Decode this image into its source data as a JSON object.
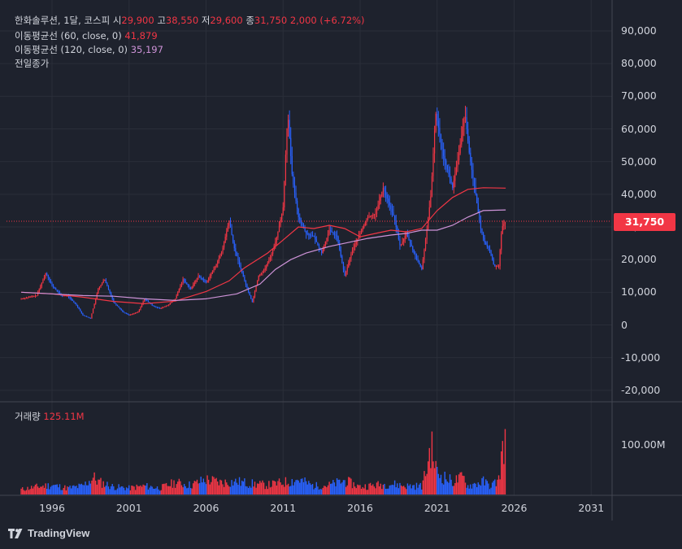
{
  "header": {
    "symbol": "한화솔루션, 1달, 코스피",
    "open_label": "시",
    "open": "29,900",
    "high_label": "고",
    "high": "38,550",
    "low_label": "저",
    "low": "29,600",
    "close_label": "종",
    "close": "31,750",
    "change": "2,000 (+6.72%)",
    "ma60_label": "이동평균선 (60, close, 0)",
    "ma60_value": "41,879",
    "ma120_label": "이동평균선 (120, close, 0)",
    "ma120_value": "35,197",
    "prev_close_label": "전일종가",
    "volume_label": "거래량",
    "volume_value": "125.11M"
  },
  "price_axis_ticks": [
    "90,000",
    "80,000",
    "70,000",
    "60,000",
    "50,000",
    "40,000",
    "30,000",
    "20,000",
    "10,000",
    "0",
    "-10,000",
    "-20,000"
  ],
  "volume_axis_tick": "100.00M",
  "last_price_badge": "31,750",
  "time_axis_ticks": [
    "1996",
    "2001",
    "2006",
    "2011",
    "2016",
    "2021",
    "2026",
    "2031"
  ],
  "brand": "TradingView",
  "colors": {
    "background": "#1e222d",
    "up": "#f23645",
    "down": "#2962ff",
    "ma60": "#f23645",
    "ma120": "#ce93d8",
    "grid": "#2a2e39",
    "text": "#d1d4dc"
  },
  "chart_data": {
    "type": "line",
    "title": "한화솔루션, 1달, 코스피",
    "x_unit": "year",
    "price_range": [
      -20000,
      90000
    ],
    "series": [
      {
        "name": "종가",
        "x": [
          1994.0,
          1995.0,
          1995.6,
          1996.0,
          1996.6,
          1997.0,
          1997.6,
          1998.0,
          1998.5,
          1999.0,
          1999.4,
          2000.0,
          2000.6,
          2001.0,
          2001.6,
          2002.0,
          2002.5,
          2003.0,
          2003.5,
          2004.0,
          2004.5,
          2005.0,
          2005.5,
          2006.0,
          2006.5,
          2007.0,
          2007.5,
          2007.8,
          2008.2,
          2008.6,
          2009.0,
          2009.4,
          2009.8,
          2010.2,
          2010.6,
          2011.0,
          2011.3,
          2011.6,
          2012.0,
          2012.5,
          2013.0,
          2013.5,
          2014.0,
          2014.5,
          2015.0,
          2015.5,
          2016.0,
          2016.5,
          2017.0,
          2017.5,
          2017.8,
          2018.2,
          2018.6,
          2019.0,
          2019.5,
          2020.0,
          2020.3,
          2020.6,
          2020.9,
          2021.1,
          2021.4,
          2021.7,
          2022.0,
          2022.4,
          2022.8,
          2023.1,
          2023.5,
          2023.8,
          2024.1,
          2024.4,
          2024.7,
          2025.0,
          2025.2,
          2025.45
        ],
        "y": [
          8000,
          9000,
          16000,
          12000,
          9000,
          9000,
          6000,
          3000,
          2000,
          11000,
          14000,
          7000,
          4000,
          3000,
          4000,
          8000,
          6000,
          5000,
          6000,
          8000,
          14000,
          11000,
          15000,
          13000,
          17000,
          22000,
          32000,
          24000,
          18000,
          12000,
          7000,
          15000,
          17000,
          21000,
          27000,
          36000,
          65000,
          45000,
          33000,
          28000,
          27000,
          22000,
          29000,
          27000,
          15000,
          23000,
          28000,
          33000,
          34000,
          42000,
          38000,
          33000,
          24000,
          28000,
          22000,
          17000,
          28000,
          40000,
          65000,
          60000,
          52000,
          47000,
          42000,
          52000,
          65000,
          52000,
          40000,
          30000,
          25000,
          23000,
          18000,
          18000,
          29900,
          31750
        ]
      },
      {
        "name": "이동평균선 (60, close, 0)",
        "x": [
          1994.0,
          1996.0,
          1998.0,
          2000.0,
          2002.0,
          2004.0,
          2006.0,
          2007.5,
          2008.5,
          2010.0,
          2011.0,
          2012.0,
          2013.0,
          2014.0,
          2015.0,
          2016.0,
          2017.0,
          2018.0,
          2019.0,
          2020.0,
          2021.0,
          2022.0,
          2023.0,
          2024.0,
          2025.45
        ],
        "y": [
          10000,
          9500,
          8500,
          7200,
          6500,
          7300,
          10200,
          13500,
          17500,
          22000,
          26000,
          30000,
          29500,
          30500,
          29500,
          27000,
          28000,
          29000,
          28500,
          29500,
          35000,
          39000,
          41500,
          42000,
          41879
        ]
      },
      {
        "name": "이동평균선 (120, close, 0)",
        "x": [
          1994.0,
          1996.0,
          1998.0,
          2000.0,
          2002.0,
          2004.0,
          2006.0,
          2008.0,
          2009.5,
          2010.5,
          2011.5,
          2012.5,
          2014.0,
          2015.5,
          2016.5,
          2018.0,
          2019.0,
          2020.0,
          2021.0,
          2022.0,
          2023.0,
          2024.0,
          2025.45
        ],
        "y": [
          10000,
          9500,
          9000,
          8800,
          8000,
          7500,
          8000,
          9500,
          12500,
          17000,
          20000,
          22000,
          24000,
          25500,
          26500,
          27500,
          28000,
          29000,
          29000,
          30500,
          33000,
          35000,
          35197
        ]
      }
    ],
    "last_close": 31750,
    "volume": {
      "x": [
        1994.0,
        1995.0,
        1996.0,
        1997.0,
        1998.0,
        1998.7,
        1999.0,
        2000.0,
        2001.0,
        2002.0,
        2003.0,
        2004.0,
        2005.0,
        2006.0,
        2007.0,
        2008.0,
        2009.0,
        2010.0,
        2011.0,
        2012.0,
        2013.0,
        2014.0,
        2015.0,
        2016.0,
        2017.0,
        2018.0,
        2019.0,
        2020.0,
        2020.3,
        2020.6,
        2021.0,
        2022.0,
        2022.7,
        2023.0,
        2024.0,
        2024.5,
        2025.0,
        2025.3,
        2025.45
      ],
      "values": [
        12,
        18,
        22,
        15,
        20,
        40,
        30,
        18,
        15,
        20,
        15,
        28,
        22,
        35,
        28,
        30,
        25,
        22,
        28,
        35,
        20,
        22,
        32,
        18,
        22,
        25,
        20,
        20,
        55,
        115,
        50,
        30,
        40,
        20,
        30,
        20,
        35,
        120,
        125.11
      ],
      "unit": "M",
      "range": [
        0,
        140
      ]
    }
  }
}
